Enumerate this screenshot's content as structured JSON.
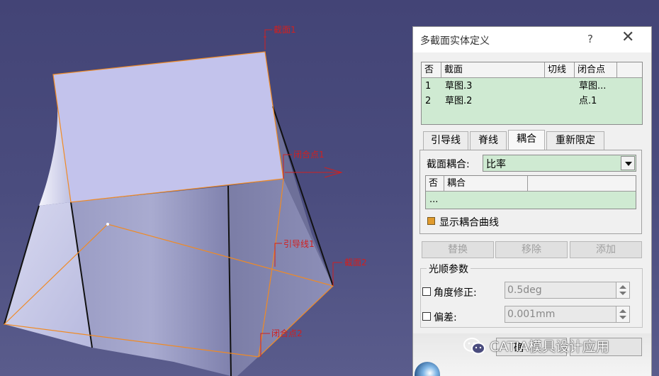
{
  "viewport": {
    "annotations": {
      "section1": "截面1",
      "closure1": "闭合点1",
      "guide1": "引导线1",
      "section2": "截面2",
      "closure2": "闭合点2"
    }
  },
  "dialog": {
    "title": "多截面实体定义",
    "help": "?",
    "close": "✕",
    "section_table": {
      "headers": [
        "否",
        "截面",
        "切线",
        "闭合点"
      ],
      "rows": [
        {
          "no": "1",
          "section": "草图.3",
          "tangent": "",
          "closure": "草图..."
        },
        {
          "no": "2",
          "section": "草图.2",
          "tangent": "",
          "closure": "点.1"
        }
      ]
    },
    "tabs": [
      "引导线",
      "脊线",
      "耦合",
      "重新限定"
    ],
    "active_tab": "耦合",
    "coupling": {
      "label": "截面耦合:",
      "value": "比率",
      "table_headers": [
        "否",
        "耦合"
      ],
      "table_rows": [
        "..."
      ],
      "show_curves_label": "显示耦合曲线"
    },
    "actions": [
      "替换",
      "移除",
      "添加"
    ],
    "smoothing": {
      "title": "光顺参数",
      "angle_label": "角度修正:",
      "angle_value": "0.5deg",
      "deviation_label": "偏差:",
      "deviation_value": "0.001mm"
    },
    "ok_partial": "确"
  },
  "watermark": {
    "text": "CATIA模具设计应用"
  },
  "colors": {
    "background": "#4a4c7e",
    "accent_green": "#cfead2",
    "annotation_red": "#d02020",
    "wire_orange": "#f08a24"
  }
}
